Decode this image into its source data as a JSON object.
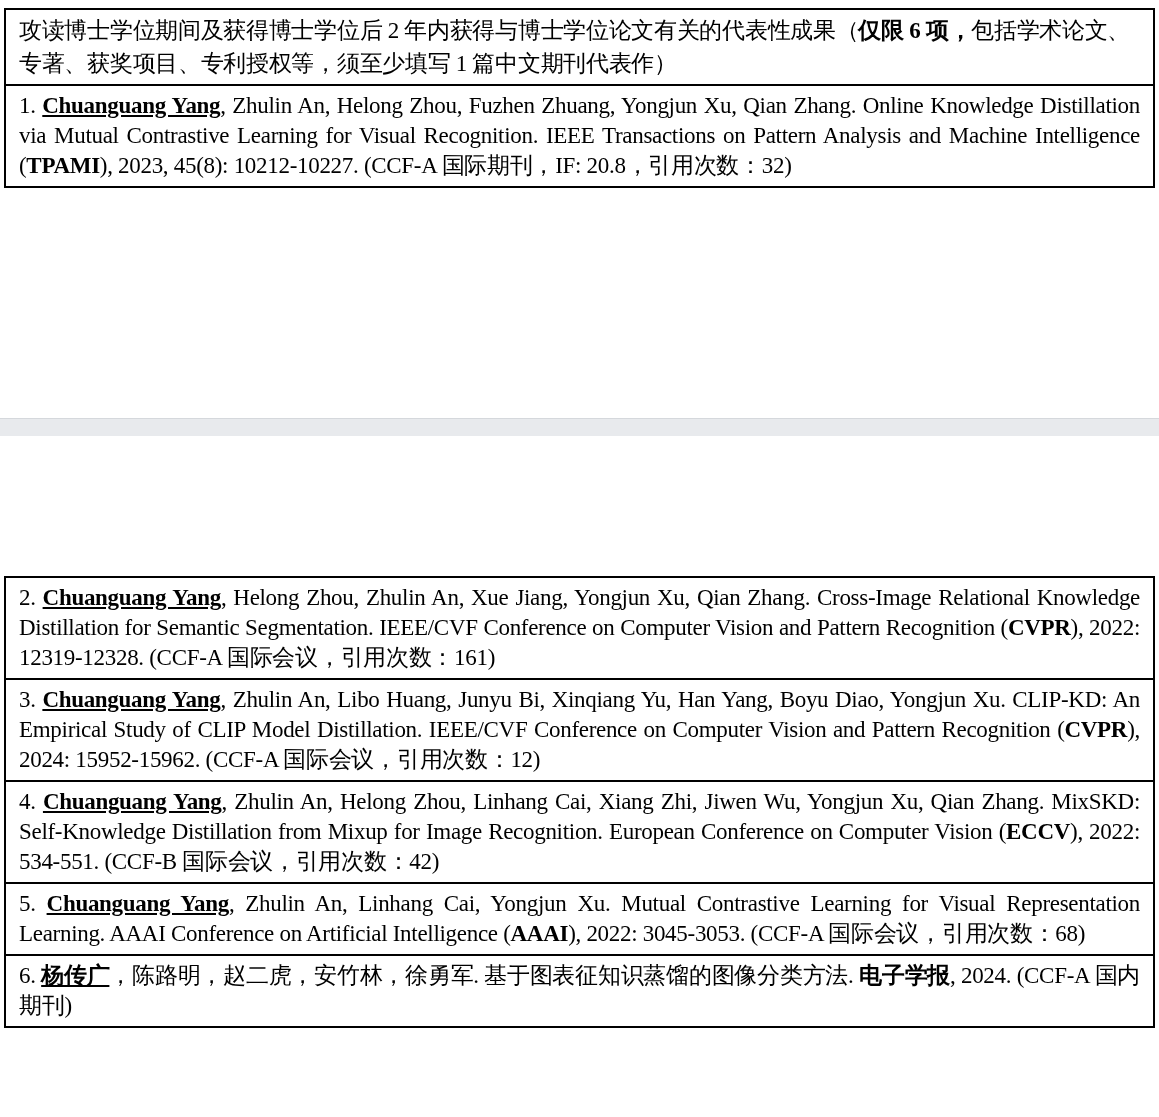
{
  "pages": [
    {
      "header": "攻读博士学位期间及获得博士学位后 2 年内获得与博士学位论文有关的代表性成果（**仅限 6 项，**包括学术论文、专著、获奖项目、专利授权等，须至少填写 1 篇中文期刊代表作）",
      "papers": [
        {
          "number": "1.",
          "first_author": "Chuanguang Yang",
          "text": ", Zhulin An, Helong Zhou, Fuzhen Zhuang, Yongjun Xu, Qian Zhang. Online Knowledge Distillation via Mutual Contrastive Learning for Visual Recognition. IEEE Transactions on Pattern Analysis and Machine Intelligence (**TPAMI**), 2023, 45(8): 10212-10227. (CCF-A 国际期刊，IF: 20.8，引用次数：32)"
        }
      ]
    },
    {
      "papers": [
        {
          "number": "2.",
          "first_author": "Chuanguang Yang",
          "text": ", Helong Zhou, Zhulin An, Xue Jiang, Yongjun Xu, Qian Zhang. Cross-Image Relational Knowledge Distillation for Semantic Segmentation. IEEE/CVF Conference on Computer Vision and Pattern Recognition (**CVPR**), 2022: 12319-12328. (CCF-A 国际会议，引用次数：161)"
        },
        {
          "number": "3.",
          "first_author": "Chuanguang Yang",
          "text": ", Zhulin An, Libo Huang, Junyu Bi, Xinqiang Yu, Han Yang, Boyu Diao, Yongjun Xu. CLIP-KD: An Empirical Study of CLIP Model Distillation. IEEE/CVF Conference on Computer Vision and Pattern Recognition (**CVPR**), 2024: 15952-15962. (CCF-A 国际会议，引用次数：12)"
        },
        {
          "number": "4.",
          "first_author": "Chuanguang Yang",
          "text": ", Zhulin An, Helong Zhou, Linhang Cai, Xiang Zhi, Jiwen Wu, Yongjun Xu, Qian Zhang. MixSKD: Self-Knowledge Distillation from Mixup for Image Recognition. European Conference on Computer Vision (**ECCV**), 2022: 534-551. (CCF-B 国际会议，引用次数：42)"
        },
        {
          "number": "5.",
          "first_author": "Chuanguang Yang",
          "text": ", Zhulin An, Linhang Cai, Yongjun Xu. Mutual Contrastive Learning for Visual Representation Learning. AAAI Conference on Artificial Intelligence (**AAAI**), 2022: 3045-3053. (CCF-A 国际会议，引用次数：68)"
        },
        {
          "number": "6.",
          "first_author": "杨传广",
          "text": "，陈路明，赵二虎，安竹林，徐勇军. 基于图表征知识蒸馏的图像分类方法. **电子学报**, 2024. (CCF-A 国内期刊)"
        }
      ]
    }
  ]
}
